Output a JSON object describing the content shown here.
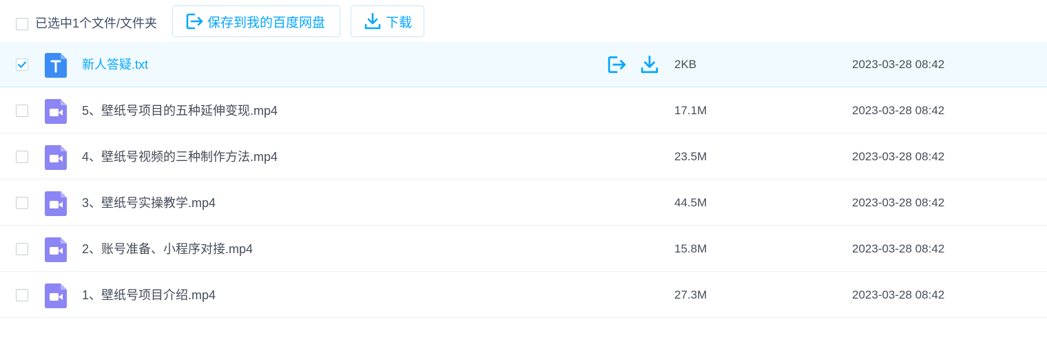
{
  "toolbar": {
    "selection_label": "已选中1个文件/文件夹",
    "save_button_label": "保存到我的百度网盘",
    "download_button_label": "下载"
  },
  "colors": {
    "accent": "#06a7ff",
    "txt_icon": "#3b8df5",
    "video_icon": "#8c85f4",
    "selected_row_bg": "#f1fafe"
  },
  "files": [
    {
      "name": "新人答疑.txt",
      "size": "2KB",
      "date": "2023-03-28 08:42",
      "type": "txt",
      "icon": "txt-file-icon",
      "selected": true
    },
    {
      "name": "5、壁纸号项目的五种延伸变现.mp4",
      "size": "17.1M",
      "date": "2023-03-28 08:42",
      "type": "video",
      "icon": "video-file-icon",
      "selected": false
    },
    {
      "name": "4、壁纸号视频的三种制作方法.mp4",
      "size": "23.5M",
      "date": "2023-03-28 08:42",
      "type": "video",
      "icon": "video-file-icon",
      "selected": false
    },
    {
      "name": "3、壁纸号实操教学.mp4",
      "size": "44.5M",
      "date": "2023-03-28 08:42",
      "type": "video",
      "icon": "video-file-icon",
      "selected": false
    },
    {
      "name": "2、账号准备、小程序对接.mp4",
      "size": "15.8M",
      "date": "2023-03-28 08:42",
      "type": "video",
      "icon": "video-file-icon",
      "selected": false
    },
    {
      "name": "1、壁纸号项目介绍.mp4",
      "size": "27.3M",
      "date": "2023-03-28 08:42",
      "type": "video",
      "icon": "video-file-icon",
      "selected": false
    }
  ]
}
